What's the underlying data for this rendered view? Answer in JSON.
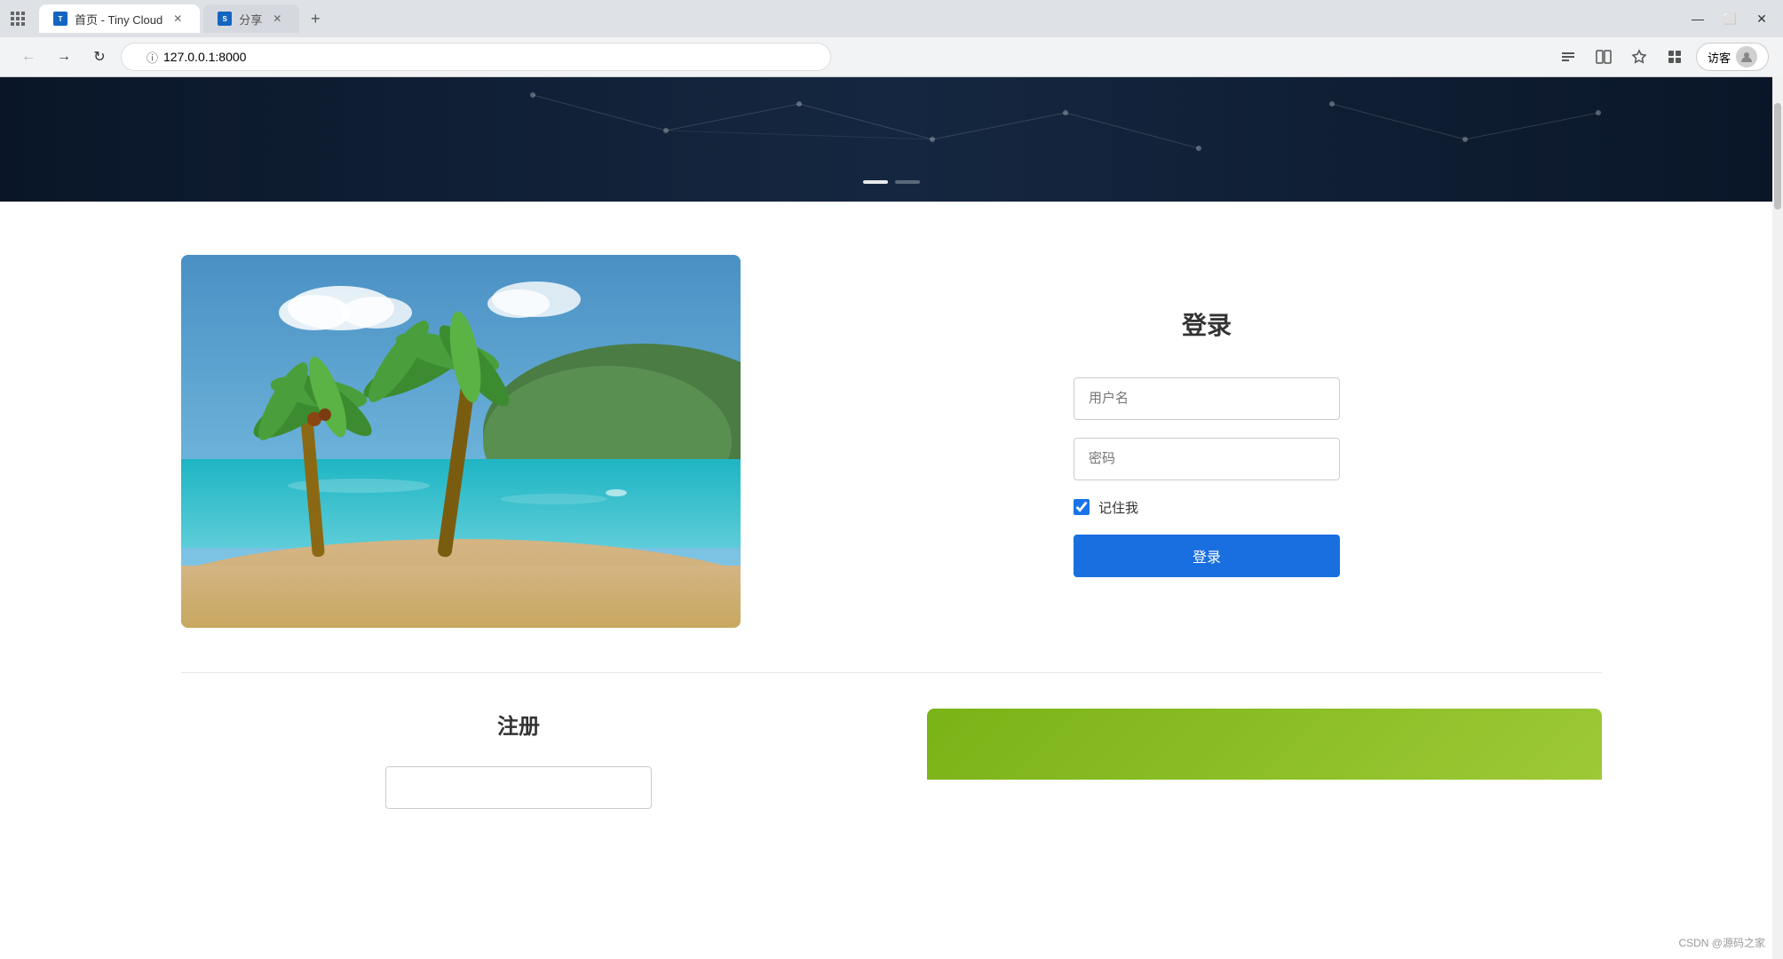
{
  "browser": {
    "tabs": [
      {
        "label": "首页 - Tiny Cloud",
        "active": true,
        "favicon": "TC"
      },
      {
        "label": "分享",
        "active": false,
        "favicon": "S"
      }
    ],
    "url": "127.0.0.1:8000",
    "new_tab_label": "+",
    "back_label": "←",
    "forward_label": "→",
    "refresh_label": "↻",
    "visitor_label": "访客"
  },
  "header": {
    "dot1_active": true,
    "dot2_active": false
  },
  "login": {
    "title": "登录",
    "username_placeholder": "用户名",
    "password_placeholder": "密码",
    "remember_label": "记住我",
    "button_label": "登录"
  },
  "register": {
    "title": "注册"
  },
  "footer": {
    "note": "CSDN @源码之家"
  }
}
